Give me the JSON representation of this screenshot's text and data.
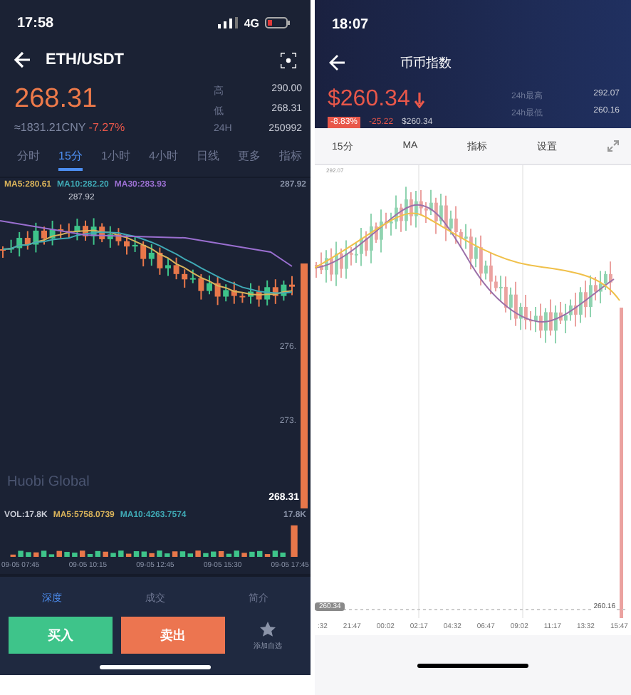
{
  "left": {
    "status_bar": {
      "time": "17:58",
      "network": "4G"
    },
    "header": {
      "title": "ETH/USDT"
    },
    "price": {
      "last": "268.31",
      "cny": "≈1831.21CNY",
      "change": "-7.27%"
    },
    "stats": [
      {
        "label": "高",
        "value": "290.00"
      },
      {
        "label": "低",
        "value": "268.31"
      },
      {
        "label": "24H",
        "value": "250992"
      }
    ],
    "tabs": [
      {
        "label": "分时",
        "selected": false
      },
      {
        "label": "15分",
        "selected": true
      },
      {
        "label": "1小时",
        "selected": false
      },
      {
        "label": "4小时",
        "selected": false
      },
      {
        "label": "日线",
        "selected": false
      },
      {
        "label": "更多",
        "selected": false
      },
      {
        "label": "指标",
        "selected": false
      }
    ],
    "ma_legend": [
      {
        "text": "MA5:280.61",
        "color": "#d8b25a"
      },
      {
        "text": "MA10:282.20",
        "color": "#3fa9b5"
      },
      {
        "text": "MA30:283.93",
        "color": "#9a6fd0"
      }
    ],
    "chart": {
      "top_price": "287.92",
      "high_mark": "287.92",
      "levels": [
        "276.",
        "273."
      ],
      "last_price": "268.31"
    },
    "volume": {
      "legend": [
        {
          "text": "VOL:17.8K",
          "color": "#c9ccd6"
        },
        {
          "text": "MA5:5758.0739",
          "color": "#d8b25a"
        },
        {
          "text": "MA10:4263.7574",
          "color": "#3fa9b5"
        }
      ],
      "max": "17.8K"
    },
    "time_axis": [
      "09-05 07:45",
      "09-05 10:15",
      "09-05 12:45",
      "09-05 15:30",
      "09-05 17:45"
    ],
    "brand": "Huobi Global",
    "bottom_tabs": [
      {
        "label": "深度",
        "selected": true
      },
      {
        "label": "成交",
        "selected": false
      },
      {
        "label": "简介",
        "selected": false
      }
    ],
    "actions": {
      "buy": "买入",
      "sell": "卖出",
      "favorite": "添加自选"
    }
  },
  "right": {
    "status_bar": {
      "time": "18:07"
    },
    "header": {
      "title": "币币指数"
    },
    "price": {
      "last": "$260.34",
      "change_pct": "-8.83%",
      "change": "-25.22",
      "index": "$260.34"
    },
    "stats": [
      {
        "label": "24h最高",
        "value": "292.07"
      },
      {
        "label": "24h最低",
        "value": "260.16"
      }
    ],
    "toolbar": [
      "15分",
      "MA",
      "指标",
      "设置"
    ],
    "chart": {
      "high_mark": "292.07",
      "last_mark": "260.34",
      "low_mark": "260.16"
    },
    "time_axis": [
      ":32",
      "21:47",
      "00:02",
      "02:17",
      "04:32",
      "06:47",
      "09:02",
      "11:17",
      "13:32",
      "15:47"
    ]
  }
}
